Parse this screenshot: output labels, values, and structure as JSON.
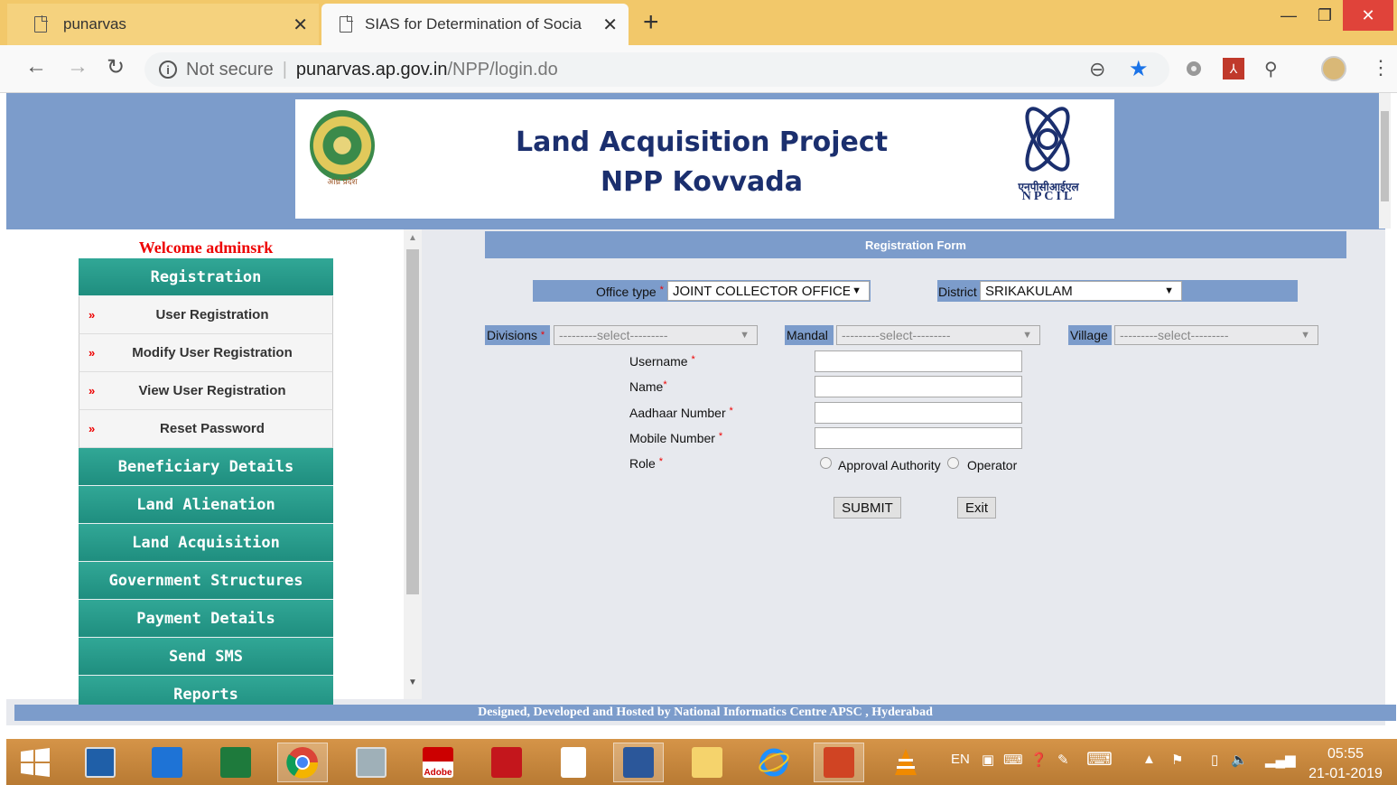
{
  "browser": {
    "tabs": [
      {
        "title": "punarvas"
      },
      {
        "title": "SIAS for Determination of Social Impact"
      }
    ],
    "new_tab_label": "+",
    "address": {
      "security": "Not secure",
      "host": "punarvas.ap.gov.in",
      "path": "/NPP/login.do"
    }
  },
  "header": {
    "title_line1": "Land Acquisition Project",
    "title_line2": "NPP Kovvada",
    "seal_caption": "आंध्र प्रदेश",
    "npcil_hindi": "एनपीसीआईएल",
    "npcil_english": "NPCIL"
  },
  "sidebar": {
    "welcome": "Welcome adminsrk",
    "sections": [
      {
        "label": "Registration"
      },
      {
        "label": "Beneficiary Details"
      },
      {
        "label": "Land Alienation"
      },
      {
        "label": "Land Acquisition"
      },
      {
        "label": "Government Structures"
      },
      {
        "label": "Payment Details"
      },
      {
        "label": "Send SMS"
      },
      {
        "label": "Reports"
      }
    ],
    "sub_items": [
      {
        "label": "User Registration"
      },
      {
        "label": "Modify User Registration"
      },
      {
        "label": "View User Registration"
      },
      {
        "label": "Reset Password"
      }
    ],
    "bullet": "»"
  },
  "form": {
    "title": "Registration Form",
    "office_type_label": "Office type",
    "office_type_value": "JOINT COLLECTOR OFFICE",
    "district_label": "District",
    "district_value": "SRIKAKULAM",
    "divisions_label": "Divisions",
    "mandal_label": "Mandal",
    "village_label": "Village",
    "select_placeholder": "---------select---------",
    "username_label": "Username",
    "name_label": "Name",
    "aadhaar_label": "Aadhaar Number",
    "mobile_label": "Mobile Number",
    "role_label": "Role",
    "role_options": [
      "Approval Authority",
      "Operator"
    ],
    "required_mark": "*",
    "submit_label": "SUBMIT",
    "exit_label": "Exit"
  },
  "footer": {
    "text": "Designed, Developed and Hosted by National Informatics Centre APSC , Hyderabad"
  },
  "taskbar": {
    "lang": "EN",
    "time": "05:55",
    "date": "21-01-2019",
    "adobe_label": "Adobe"
  },
  "colors": {
    "header_blue": "#7c9ccb",
    "menu_teal": "#2a9d8f",
    "welcome_red": "#ee0000",
    "tab_yellow": "#f2c86a"
  }
}
